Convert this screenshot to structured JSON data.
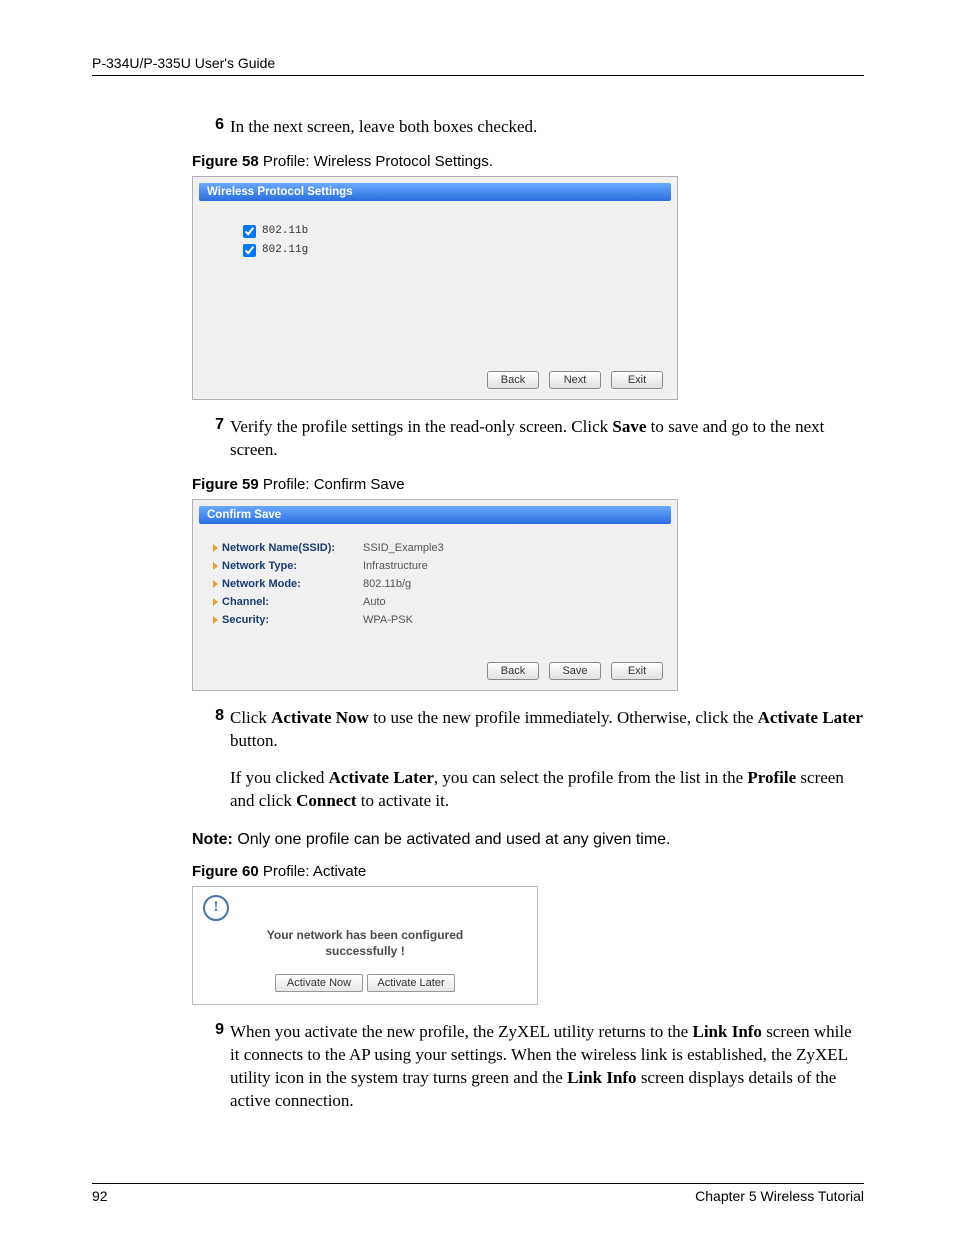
{
  "header": "P-334U/P-335U User's Guide",
  "steps": {
    "s6_num": "6",
    "s6_text": "In the next screen, leave both boxes checked.",
    "s7_num": "7",
    "s7_pre": "Verify the profile settings in the read-only screen. Click ",
    "s7_bold": "Save",
    "s7_post": " to save and go to the next screen.",
    "s8_num": "8",
    "s8_a_pre": "Click ",
    "s8_a_b1": "Activate Now",
    "s8_a_mid": " to use the new profile immediately. Otherwise, click the ",
    "s8_a_b2": "Activate Later",
    "s8_a_post": " button.",
    "s8_b_pre": "If you clicked ",
    "s8_b_b1": "Activate Later",
    "s8_b_mid": ", you can select the profile from the list in the ",
    "s8_b_b2": "Profile",
    "s8_b_mid2": " screen and click ",
    "s8_b_b3": "Connect",
    "s8_b_post": " to activate it.",
    "s9_num": "9",
    "s9_pre": "When you activate the new profile, the ZyXEL utility returns to the ",
    "s9_b1": "Link Info",
    "s9_mid1": " screen while it connects to the AP using your settings. When the wireless link is established, the ZyXEL utility icon in the system tray turns green and the ",
    "s9_b2": "Link Info",
    "s9_post": " screen displays details of the active connection."
  },
  "figs": {
    "f58_num": "Figure 58",
    "f58_cap": "   Profile: Wireless Protocol Settings.",
    "f59_num": "Figure 59",
    "f59_cap": "   Profile: Confirm Save",
    "f60_num": "Figure 60",
    "f60_cap": "   Profile: Activate"
  },
  "note": {
    "label": "Note:",
    "text": " Only one profile can be activated and used at any given time."
  },
  "dialog1": {
    "title": "Wireless Protocol Settings",
    "cb1": "802.11b",
    "cb2": "802.11g",
    "btn_back": "Back",
    "btn_next": "Next",
    "btn_exit": "Exit"
  },
  "dialog2": {
    "title": "Confirm Save",
    "rows": [
      {
        "label": "Network Name(SSID):",
        "value": "SSID_Example3"
      },
      {
        "label": "Network Type:",
        "value": "Infrastructure"
      },
      {
        "label": "Network Mode:",
        "value": "802.11b/g"
      },
      {
        "label": "Channel:",
        "value": "Auto"
      },
      {
        "label": "Security:",
        "value": "WPA-PSK"
      }
    ],
    "btn_back": "Back",
    "btn_save": "Save",
    "btn_exit": "Exit"
  },
  "dialog3": {
    "msg1": "Your network has been configured",
    "msg2": "successfully !",
    "btn_now": "Activate Now",
    "btn_later": "Activate Later"
  },
  "footer": {
    "page": "92",
    "chapter": "Chapter 5 Wireless Tutorial"
  }
}
